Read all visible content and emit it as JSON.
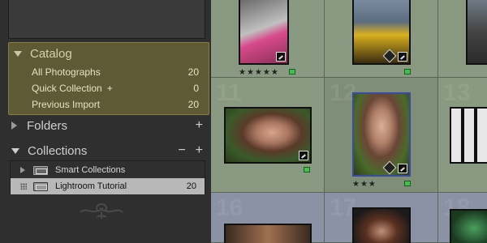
{
  "catalog": {
    "title": "Catalog",
    "rows": [
      {
        "label": "All Photographs",
        "count": "20"
      },
      {
        "label": "Quick Collection",
        "plus": "+",
        "count": "0"
      },
      {
        "label": "Previous Import",
        "count": "20"
      }
    ]
  },
  "folders": {
    "title": "Folders",
    "add": "+"
  },
  "collections": {
    "title": "Collections",
    "minus": "−",
    "add": "+",
    "items": [
      {
        "label": "Smart Collections",
        "count": ""
      },
      {
        "label": "Lightroom Tutorial",
        "count": "20"
      }
    ]
  },
  "grid": {
    "cells": [
      {
        "number": "",
        "stars": "★★★★★"
      },
      {
        "number": "",
        "stars": ""
      },
      {
        "number": "",
        "stars": ""
      },
      {
        "number": "11",
        "stars": ""
      },
      {
        "number": "12",
        "stars": "★★★"
      },
      {
        "number": "13",
        "stars": ""
      },
      {
        "number": "16",
        "stars": ""
      },
      {
        "number": "17",
        "stars": ""
      },
      {
        "number": "18",
        "stars": ""
      }
    ]
  },
  "colors": {
    "catalog_bg": "#5d5a35",
    "grid_green": "#8a9982",
    "grid_blue": "#8b92a6",
    "flag_green": "#3ec24a"
  }
}
